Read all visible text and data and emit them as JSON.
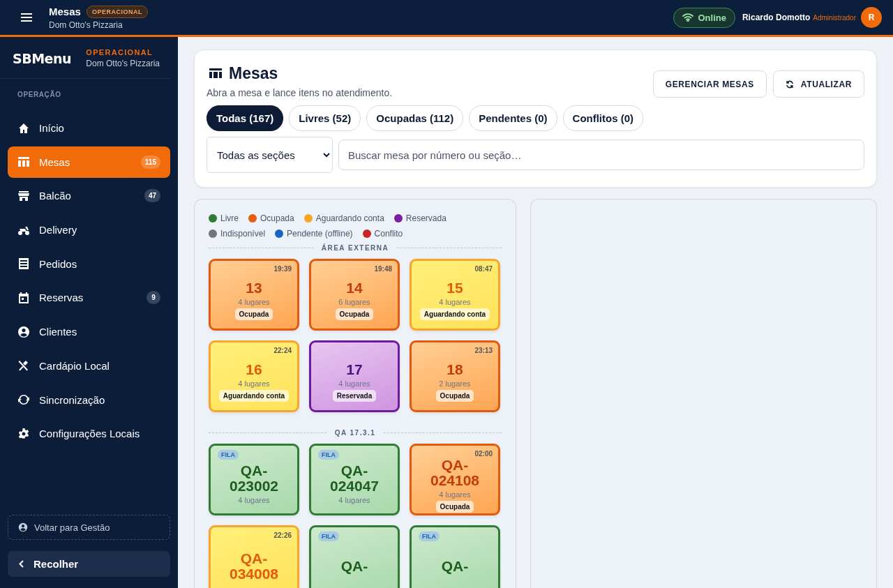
{
  "header": {
    "title": "Mesas",
    "badge": "OPERACIONAL",
    "subtitle": "Dom Otto's Pizzaria",
    "connection": "Online",
    "user_name": "Ricardo Domotto",
    "user_role": "Administrador",
    "avatar": "R"
  },
  "sidebar": {
    "brand": "SBMenu",
    "mode": "OPERACIONAL",
    "store": "Dom Otto's Pizzaria",
    "section": "OPERAÇÃO",
    "items": [
      {
        "label": "Início",
        "selected": false
      },
      {
        "label": "Mesas",
        "selected": true,
        "count": "115"
      },
      {
        "label": "Balcão",
        "selected": false,
        "count": "47"
      },
      {
        "label": "Delivery",
        "selected": false
      },
      {
        "label": "Pedidos",
        "selected": false
      },
      {
        "label": "Reservas",
        "selected": false,
        "count": "9"
      },
      {
        "label": "Clientes",
        "selected": false
      },
      {
        "label": "Cardápio Local",
        "selected": false
      },
      {
        "label": "Sincronização",
        "selected": false
      },
      {
        "label": "Configurações Locais",
        "selected": false
      }
    ],
    "back": "Voltar para Gestão",
    "collapse": "Recolher"
  },
  "page": {
    "title": "Mesas",
    "subtitle": "Abra a mesa e lance itens no atendimento.",
    "buttons": [
      "GERENCIAR MESAS",
      "ATUALIZAR"
    ],
    "filters": [
      {
        "label": "Todas (167)",
        "selected": true
      },
      {
        "label": "Livres (52)",
        "selected": false
      },
      {
        "label": "Ocupadas (112)",
        "selected": false
      },
      {
        "label": "Pendentes (0)",
        "selected": false
      },
      {
        "label": "Conflitos (0)",
        "selected": false
      }
    ],
    "section_select": "Todas as seções",
    "search": {
      "placeholder": "Buscar mesa por número ou seção…"
    }
  },
  "legend": [
    {
      "label": "Livre",
      "color": "#2e7d32"
    },
    {
      "label": "Ocupada",
      "color": "#e65c12"
    },
    {
      "label": "Aguardando conta",
      "color": "#f5a623"
    },
    {
      "label": "Reservada",
      "color": "#7b1fa2"
    },
    {
      "label": "Indisponível",
      "color": "#757575"
    },
    {
      "label": "Pendente (offline)",
      "color": "#1565c0"
    },
    {
      "label": "Conflito",
      "color": "#c62828"
    }
  ],
  "sections": [
    {
      "title": "ÁREA EXTERNA",
      "tables": [
        {
          "kind": "occupied",
          "name": "13",
          "time": "19:39",
          "seats": "4 lugares",
          "status": "Ocupada"
        },
        {
          "kind": "occupied",
          "name": "14",
          "time": "19:48",
          "seats": "6 lugares",
          "status": "Ocupada"
        },
        {
          "kind": "awaiting",
          "name": "15",
          "time": "08:47",
          "seats": "4 lugares",
          "status": "Aguardando conta"
        },
        {
          "kind": "awaiting",
          "name": "16",
          "time": "22:24",
          "seats": "4 lugares",
          "status": "Aguardando conta"
        },
        {
          "kind": "reserved",
          "name": "17",
          "seats": "4 lugares",
          "status": "Reservada"
        },
        {
          "kind": "occupied",
          "name": "18",
          "time": "23:13",
          "seats": "2 lugares",
          "status": "Ocupada"
        }
      ]
    },
    {
      "title": "QA 17.3.1",
      "tables": [
        {
          "kind": "free",
          "tag": "FILA",
          "name": "QA-023002",
          "seats": "4 lugares"
        },
        {
          "kind": "free",
          "tag": "FILA",
          "name": "QA-024047",
          "seats": "4 lugares"
        },
        {
          "kind": "occupied",
          "name": "QA-024108",
          "time": "02:00",
          "seats": "4 lugares",
          "status": "Ocupada"
        },
        {
          "kind": "awaiting",
          "name": "QA-034008",
          "time": "22:26"
        },
        {
          "kind": "free",
          "tag": "FILA",
          "name": "QA-"
        },
        {
          "kind": "free",
          "tag": "FILA",
          "name": "QA-"
        }
      ]
    }
  ]
}
